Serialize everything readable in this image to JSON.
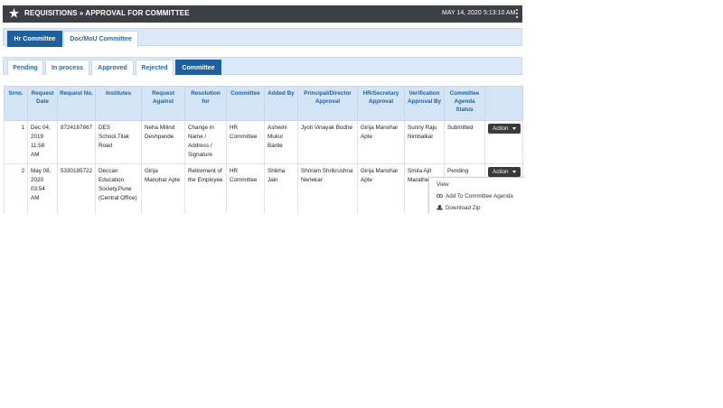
{
  "header": {
    "title": "REQUISITIONS » APPROVAL FOR COMMITTEE",
    "date": "MAY 14, 2020",
    "time": "5:13:10 AM"
  },
  "committee_tabs": [
    "Hr Committee",
    "Doc/MoU Committee"
  ],
  "status_tabs": [
    "Pending",
    "In process",
    "Approved",
    "Rejected",
    "Committee"
  ],
  "table": {
    "columns": [
      "Srno.",
      "Request Date",
      "Request No.",
      "Institutes",
      "Request Against",
      "Resolution for",
      "Committee",
      "Added By",
      "Principal/Director Approval",
      "HR/Secretary Approval",
      "Verification Approval By",
      "Committee Agenda Status",
      ""
    ],
    "rows": [
      {
        "srno": "1",
        "date": "Dec 04, 2019 11:58 AM",
        "reqno": "8724167867",
        "institute": "DES School,Tilak Road",
        "against": "Neha Milind Deshpande",
        "resolution": "Change in Name / Address / Signature",
        "committee": "HR Committee",
        "added_by": "Ashwini Mukul Barde",
        "principal": "Jyoti Vinayak Bodhe",
        "hr": "Girija Manohar Apte",
        "verification": "Sunny Raju Nimbalkar",
        "status": "Submitted",
        "action": "Action"
      },
      {
        "srno": "2",
        "date": "May 08, 2020 03:54 AM",
        "reqno": "5330185722",
        "institute": "Deccan Education Society,Pune (Central Office)",
        "against": "Girija Manohar Apte",
        "resolution": "Retirement of the Employee",
        "committee": "HR Committee",
        "added_by": "Shikha Jain",
        "principal": "Shriram Shrikrushna Nerlekar",
        "hr": "Girija Manohar Apte",
        "verification": "Smita Ajit Marathe",
        "status": "Pending",
        "action": "Action"
      }
    ]
  },
  "action_menu": {
    "view": "View",
    "add_agenda": "Add To Committee Agenda",
    "download_zip": "Download Zip"
  }
}
